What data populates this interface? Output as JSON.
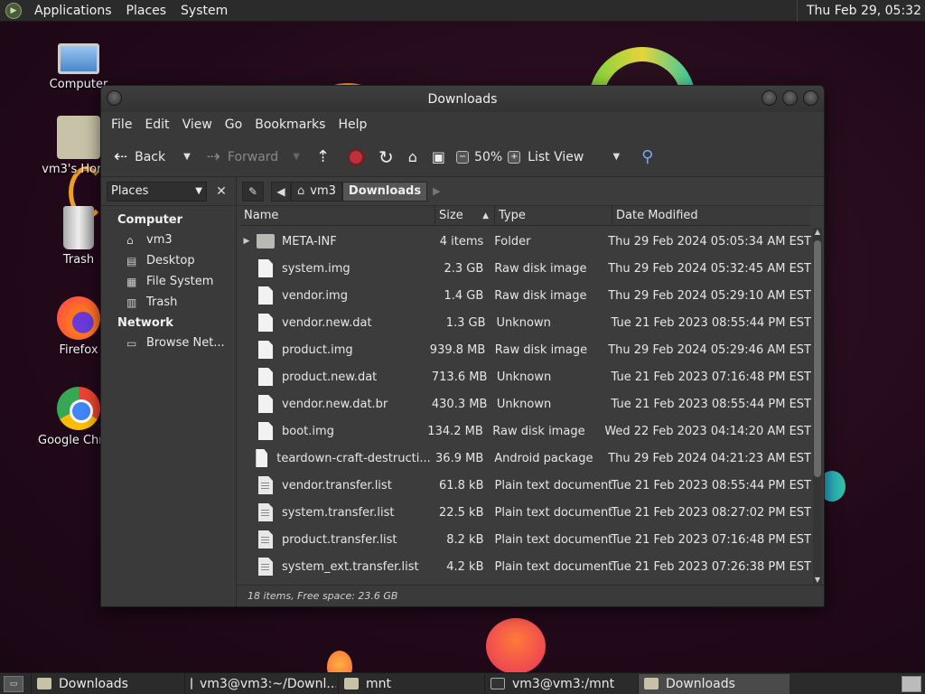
{
  "top_panel": {
    "menu": [
      "Applications",
      "Places",
      "System"
    ],
    "clock": "Thu Feb 29, 05:32"
  },
  "desktop_icons": [
    {
      "label": "Computer",
      "icon": "computer-icon"
    },
    {
      "label": "vm3's Home",
      "icon": "home-folder-icon"
    },
    {
      "label": "Trash",
      "icon": "trash-icon"
    },
    {
      "label": "Firefox",
      "icon": "firefox-icon"
    },
    {
      "label": "Google Chrome",
      "icon": "chrome-icon"
    }
  ],
  "window": {
    "title": "Downloads",
    "menu": [
      "File",
      "Edit",
      "View",
      "Go",
      "Bookmarks",
      "Help"
    ],
    "toolbar": {
      "back": "Back",
      "forward": "Forward",
      "zoom": "50%",
      "view_mode": "List View"
    },
    "sidebar": {
      "selector": "Places",
      "sections": [
        {
          "title": "Computer",
          "items": [
            {
              "label": "vm3",
              "icon": "home-icon"
            },
            {
              "label": "Desktop",
              "icon": "desktop-icon"
            },
            {
              "label": "File System",
              "icon": "drive-icon"
            },
            {
              "label": "Trash",
              "icon": "trash-icon"
            }
          ]
        },
        {
          "title": "Network",
          "items": [
            {
              "label": "Browse Net...",
              "icon": "network-icon"
            }
          ]
        }
      ]
    },
    "pathbar": [
      "vm3",
      "Downloads"
    ],
    "columns": {
      "name": "Name",
      "size": "Size",
      "type": "Type",
      "date": "Date Modified"
    },
    "files": [
      {
        "name": "META-INF",
        "size": "4 items",
        "type": "Folder",
        "date": "Thu 29 Feb 2024 05:05:34 AM EST",
        "kind": "folder"
      },
      {
        "name": "system.img",
        "size": "2.3 GB",
        "type": "Raw disk image",
        "date": "Thu 29 Feb 2024 05:32:45 AM EST",
        "kind": "file"
      },
      {
        "name": "vendor.img",
        "size": "1.4 GB",
        "type": "Raw disk image",
        "date": "Thu 29 Feb 2024 05:29:10 AM EST",
        "kind": "file"
      },
      {
        "name": "vendor.new.dat",
        "size": "1.3 GB",
        "type": "Unknown",
        "date": "Tue 21 Feb 2023 08:55:44 PM EST",
        "kind": "file"
      },
      {
        "name": "product.img",
        "size": "939.8 MB",
        "type": "Raw disk image",
        "date": "Thu 29 Feb 2024 05:29:46 AM EST",
        "kind": "file"
      },
      {
        "name": "product.new.dat",
        "size": "713.6 MB",
        "type": "Unknown",
        "date": "Tue 21 Feb 2023 07:16:48 PM EST",
        "kind": "file"
      },
      {
        "name": "vendor.new.dat.br",
        "size": "430.3 MB",
        "type": "Unknown",
        "date": "Tue 21 Feb 2023 08:55:44 PM EST",
        "kind": "file"
      },
      {
        "name": "boot.img",
        "size": "134.2 MB",
        "type": "Raw disk image",
        "date": "Wed 22 Feb 2023 04:14:20 AM EST",
        "kind": "file"
      },
      {
        "name": "teardown-craft-destructi...",
        "size": "36.9 MB",
        "type": "Android package",
        "date": "Thu 29 Feb 2024 04:21:23 AM EST",
        "kind": "file"
      },
      {
        "name": "vendor.transfer.list",
        "size": "61.8 kB",
        "type": "Plain text document",
        "date": "Tue 21 Feb 2023 08:55:44 PM EST",
        "kind": "text"
      },
      {
        "name": "system.transfer.list",
        "size": "22.5 kB",
        "type": "Plain text document",
        "date": "Tue 21 Feb 2023 08:27:02 PM EST",
        "kind": "text"
      },
      {
        "name": "product.transfer.list",
        "size": "8.2 kB",
        "type": "Plain text document",
        "date": "Tue 21 Feb 2023 07:16:48 PM EST",
        "kind": "text"
      },
      {
        "name": "system_ext.transfer.list",
        "size": "4.2 kB",
        "type": "Plain text document",
        "date": "Tue 21 Feb 2023 07:26:38 PM EST",
        "kind": "text"
      }
    ],
    "status": "18 items, Free space: 23.6 GB"
  },
  "taskbar": [
    {
      "label": "Downloads",
      "icon": "folder-icon",
      "active": false
    },
    {
      "label": "vm3@vm3:~/Downl...",
      "icon": "terminal-icon",
      "active": false
    },
    {
      "label": "mnt",
      "icon": "folder-icon",
      "active": false
    },
    {
      "label": "vm3@vm3:/mnt",
      "icon": "terminal-icon",
      "active": false
    },
    {
      "label": "Downloads",
      "icon": "folder-icon",
      "active": true
    }
  ]
}
